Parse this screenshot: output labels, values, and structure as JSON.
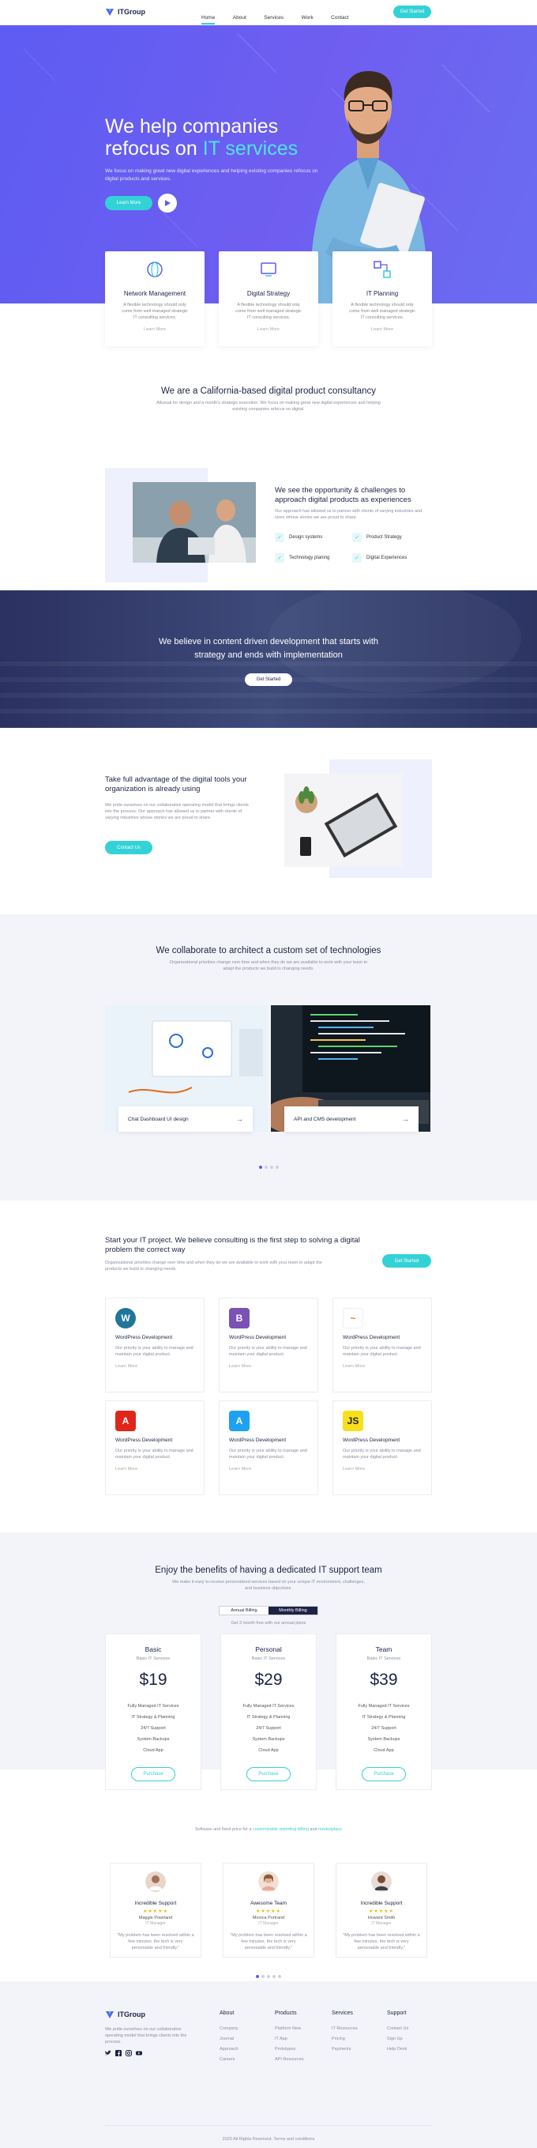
{
  "header": {
    "brand": "ITGroup",
    "nav": [
      "Home",
      "About",
      "Services",
      "Work",
      "Contact"
    ],
    "cta": "Get Started"
  },
  "hero": {
    "title_1": "We help companies",
    "title_2": "refocus on",
    "title_hl": "IT services",
    "desc": "We focus on making great new digital experiences and helping existing companies refocus on digital products and services.",
    "learn": "Learn More"
  },
  "features": [
    {
      "title": "Network Management",
      "desc": "A flexible technology should only come from well managed strategic IT consulting services.",
      "link": "Learn More"
    },
    {
      "title": "Digital Strategy",
      "desc": "A flexible technology should only come from well managed strategic IT consulting services.",
      "link": "Learn More"
    },
    {
      "title": "IT Planning",
      "desc": "A flexible technology should only come from well managed strategic IT consulting services.",
      "link": "Learn More"
    }
  ],
  "about": {
    "title": "We are a California-based digital product consultancy",
    "desc": "Allusual for design and a month's strategic execution. We focus on making great new digital experiences and helping existing companies refocus on digital.",
    "sub_title": "We see the opportunity & challenges to approach digital products as experiences",
    "sub_desc": "Our approach has allowed us to partner with clients of varying industries and sizes whose stories we are proud to share.",
    "checks": [
      "Design systems",
      "Product Strategy",
      "Technology planing",
      "Digital Experiences"
    ]
  },
  "banner": {
    "title_1": "We believe in content driven development that starts with",
    "title_2": "strategy and ends with implementation",
    "cta": "Get Started"
  },
  "tools": {
    "title": "Take full advantage of the digital tools your organization is already using",
    "desc": "We pride ourselves on our collaborative operating model that brings clients into the process. Our approach has allowed us to partner with clients of varying industries whose stories we are proud to share.",
    "cta": "Contact Us"
  },
  "tech": {
    "title": "We collaborate to architect a custom set of technologies",
    "desc": "Organizational priorities change over time and when they do we are available to work with your team to adapt the products we build to changing needs.",
    "cards": [
      "Chat Dashboard UI design",
      "API and CMS development"
    ],
    "arrow": "→"
  },
  "services": {
    "title": "Start your IT project. We believe consulting is the first step to solving a digital problem the correct way",
    "desc": "Organizational priorities change over time and when they do we are available to work with your team to adapt the products we build to changing needs.",
    "cta": "Get Started",
    "tiles": [
      {
        "title": "WordPress Development",
        "desc": "Our priority is your ability to manage and maintain your digital product.",
        "link": "Learn More",
        "icon": "W",
        "color": "#21759b"
      },
      {
        "title": "WordPress Development",
        "desc": "Our priority is your ability to manage and maintain your digital product.",
        "link": "Learn More",
        "icon": "B",
        "color": "#7952b3"
      },
      {
        "title": "WordPress Development",
        "desc": "Our priority is your ability to manage and maintain your digital product.",
        "link": "Learn More",
        "icon": "~",
        "color": "#f4750e"
      },
      {
        "title": "WordPress Development",
        "desc": "Our priority is your ability to manage and maintain your digital product.",
        "link": "Learn More",
        "icon": "A",
        "color": "#e0261b"
      },
      {
        "title": "WordPress Development",
        "desc": "Our priority is your ability to manage and maintain your digital product.",
        "link": "Learn More",
        "icon": "A",
        "color": "#1da1f2"
      },
      {
        "title": "WordPress Development",
        "desc": "Our priority is your ability to manage and maintain your digital product.",
        "link": "Learn More",
        "icon": "JS",
        "color": "#f7df1e"
      }
    ]
  },
  "pricing": {
    "title": "Enjoy the benefits of having a dedicated IT support team",
    "desc": "We make it easy to receive personalized services based on your unique IT environment, challenges, and business objectives.",
    "toggle": [
      "Annual Billing",
      "Monthly Billing"
    ],
    "note": "Get 3 month free with our annual plans",
    "plans": [
      {
        "name": "Basic",
        "sub": "Basic IT Services",
        "price": "$19",
        "features": [
          "Fully Managed IT Services",
          "IT Strategy & Planning",
          "24/7 Support",
          "System Backups",
          "Cloud App"
        ],
        "cta": "Purchase"
      },
      {
        "name": "Personal",
        "sub": "Basic IT Services",
        "price": "$29",
        "features": [
          "Fully Managed IT Services",
          "IT Strategy & Planning",
          "24/7 Support",
          "System Backups",
          "Cloud App"
        ],
        "cta": "Purchase"
      },
      {
        "name": "Team",
        "sub": "Basic IT Services",
        "price": "$39",
        "features": [
          "Fully Managed IT Services",
          "IT Strategy & Planning",
          "24/7 Support",
          "System Backups",
          "Cloud App"
        ],
        "cta": "Purchase"
      }
    ],
    "footnote_pre": "Software and fixed price for a",
    "footnote_link_1": "customizable reporting billing",
    "footnote_mid": "and",
    "footnote_link_2": "marketplace"
  },
  "testimonials": [
    {
      "title": "Incredible Support",
      "stars": "★★★★★",
      "name": "Maggie Powrland",
      "role": "IT Manager",
      "quote": "\"My problem has been resolved within a few minutes. the tech is very personable and friendly.\""
    },
    {
      "title": "Awesome Team",
      "stars": "★★★★★",
      "name": "Monica Portrand",
      "role": "IT Manager",
      "quote": "\"My problem has been resolved within a few minutes. the tech is very personable and friendly.\""
    },
    {
      "title": "Incredible Support",
      "stars": "★★★★★",
      "name": "Howard Smith",
      "role": "IT Manager",
      "quote": "\"My problem has been resolved within a few minutes. the tech is very personable and friendly.\""
    }
  ],
  "footer": {
    "brand": "ITGroup",
    "desc": "We pride ourselves on our collaborative operating model that brings clients into the process.",
    "cols": [
      {
        "head": "About",
        "items": [
          "Company",
          "Journal",
          "Approach",
          "Careers"
        ]
      },
      {
        "head": "Products",
        "items": [
          "Platform New",
          "IT App",
          "Prototypes",
          "API Resources"
        ]
      },
      {
        "head": "Services",
        "items": [
          "IT Resources",
          "Pricing",
          "Payments"
        ]
      },
      {
        "head": "Support",
        "items": [
          "Contact Us",
          "Sign Up",
          "Help Desk"
        ]
      }
    ],
    "copyright": "2020 All Rights Reserved. Terms and conditions"
  },
  "colors": {
    "primary": "#5d5cf3",
    "accent": "#33d2d6",
    "dark": "#1d2345"
  }
}
